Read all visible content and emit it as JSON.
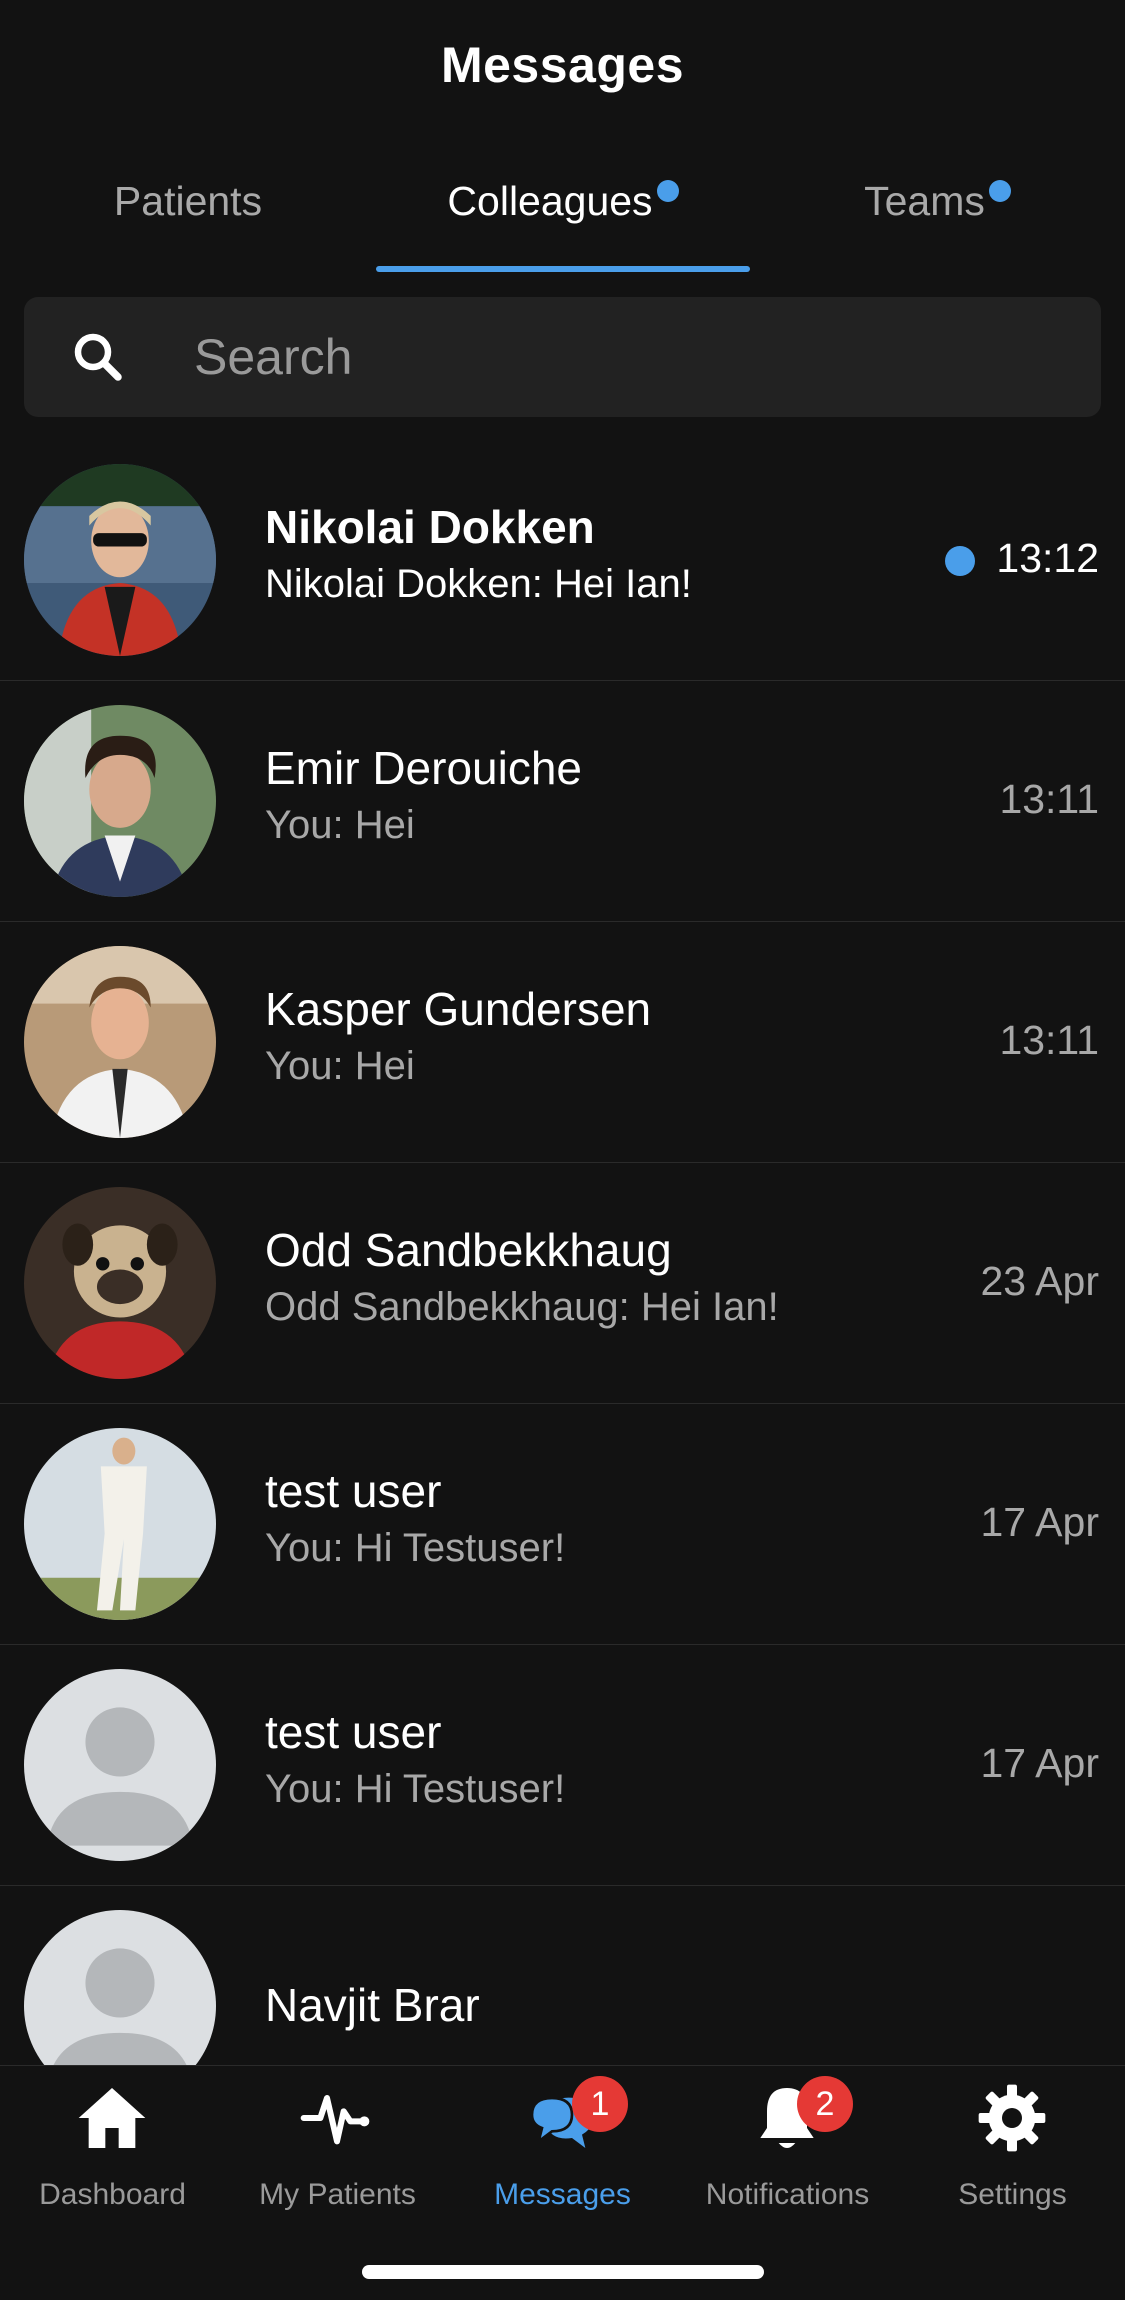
{
  "header": {
    "title": "Messages"
  },
  "tabs": [
    {
      "label": "Patients",
      "active": false,
      "dot": false
    },
    {
      "label": "Colleagues",
      "active": true,
      "dot": true
    },
    {
      "label": "Teams",
      "active": false,
      "dot": true
    }
  ],
  "search": {
    "placeholder": "Search"
  },
  "conversations": [
    {
      "name": "Nikolai Dokken",
      "preview": "Nikolai Dokken: Hei Ian!",
      "time": "13:12",
      "unread": true,
      "avatar": "photo"
    },
    {
      "name": "Emir Derouiche",
      "preview": "You: Hei",
      "time": "13:11",
      "unread": false,
      "avatar": "photo"
    },
    {
      "name": "Kasper Gundersen",
      "preview": "You: Hei",
      "time": "13:11",
      "unread": false,
      "avatar": "photo"
    },
    {
      "name": "Odd Sandbekkhaug",
      "preview": "Odd Sandbekkhaug: Hei Ian!",
      "time": "23 Apr",
      "unread": false,
      "avatar": "photo"
    },
    {
      "name": "test user",
      "preview": "You: Hi Testuser!",
      "time": "17 Apr",
      "unread": false,
      "avatar": "photo"
    },
    {
      "name": "test user",
      "preview": "You: Hi Testuser!",
      "time": "17 Apr",
      "unread": false,
      "avatar": "placeholder"
    },
    {
      "name": "Navjit Brar",
      "preview": "",
      "time": "",
      "unread": false,
      "avatar": "placeholder"
    }
  ],
  "tabbar": [
    {
      "label": "Dashboard",
      "icon": "home-icon",
      "active": false
    },
    {
      "label": "My Patients",
      "icon": "heartbeat-icon",
      "active": false
    },
    {
      "label": "Messages",
      "icon": "chat-bubbles-icon",
      "active": true,
      "badge": "1"
    },
    {
      "label": "Notifications",
      "icon": "bell-icon",
      "active": false,
      "badge": "2"
    },
    {
      "label": "Settings",
      "icon": "gear-icon",
      "active": false
    }
  ],
  "colors": {
    "accent": "#4a9eea",
    "background": "#121212",
    "badge": "#e53935",
    "search_bg": "#222222"
  }
}
